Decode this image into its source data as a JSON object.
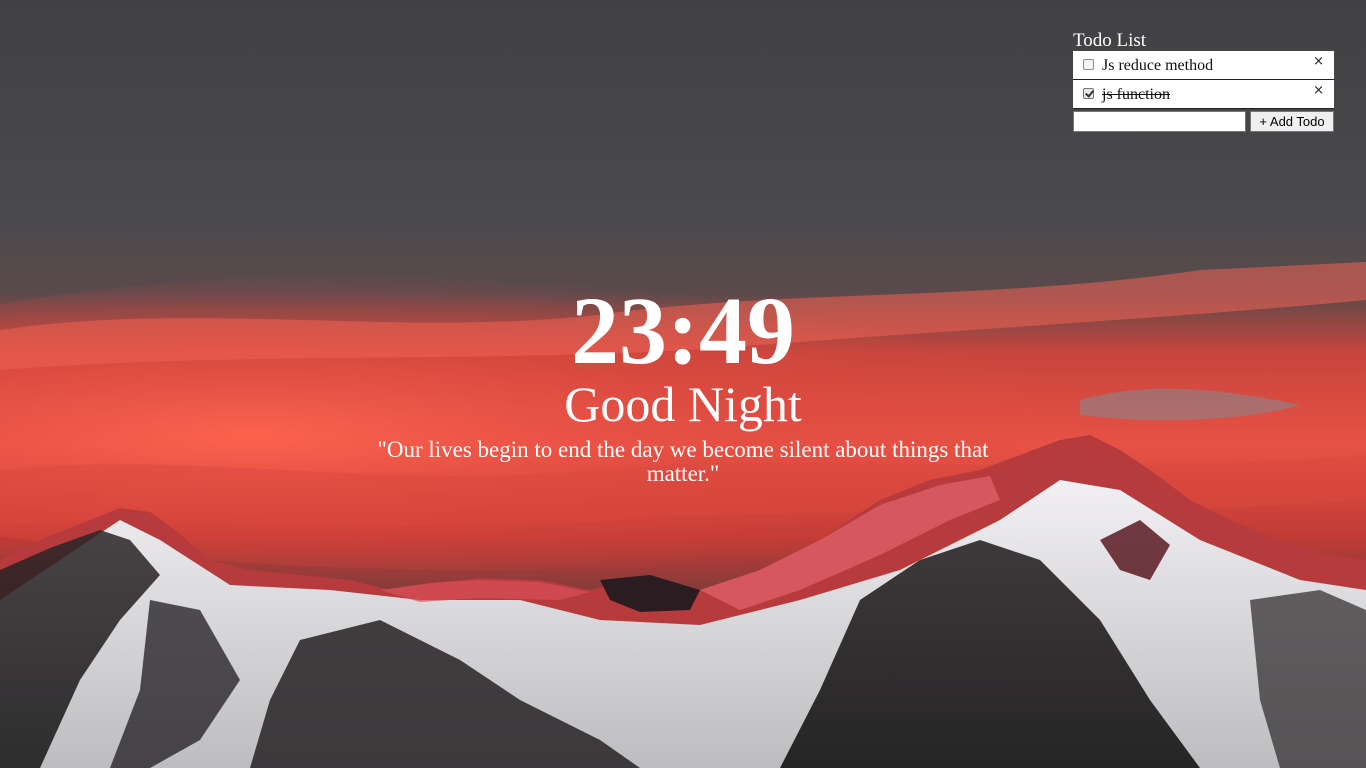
{
  "todo": {
    "title": "Todo List",
    "items": [
      {
        "text": "Js reduce method",
        "done": false,
        "remove_label": "×"
      },
      {
        "text": "js function",
        "done": true,
        "remove_label": "×"
      }
    ],
    "input_value": "",
    "add_label": "+ Add Todo"
  },
  "clock": {
    "time": "23:49",
    "greeting": "Good Night",
    "quote": "\"Our lives begin to end the day we become silent about things that matter.\""
  },
  "background": {
    "subject": "snow-capped mountain range under red sunset clouds",
    "colors": {
      "sky": "#47474a",
      "glow": "#f2564a",
      "snow": "#e4e4e6",
      "rock": "#1e1c1e"
    }
  }
}
